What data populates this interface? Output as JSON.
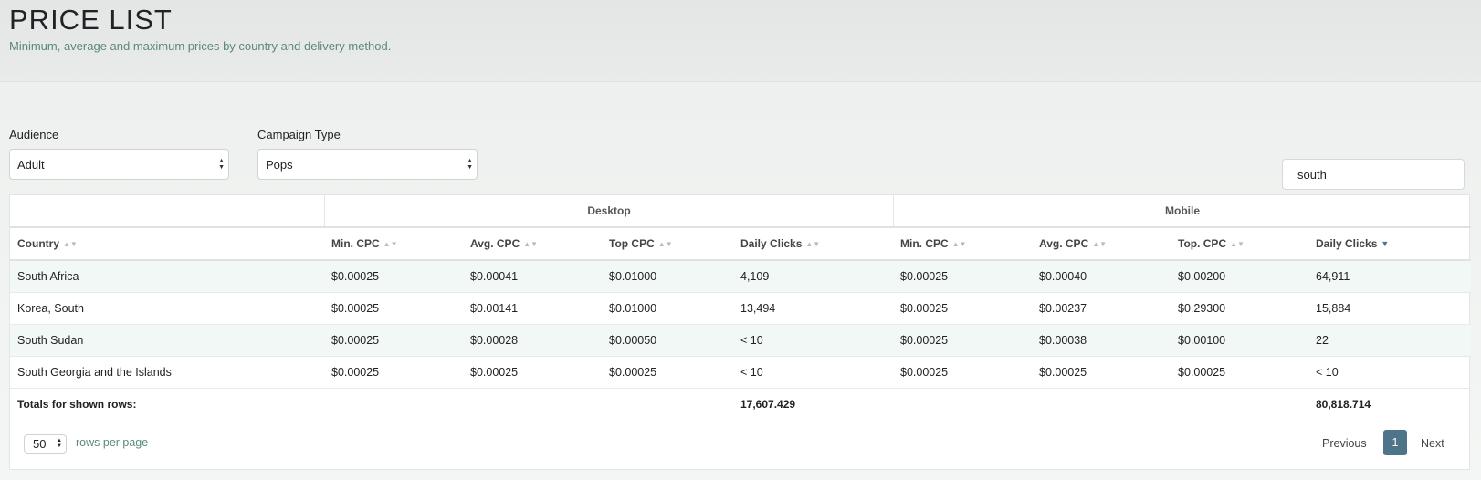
{
  "header": {
    "title": "PRICE LIST",
    "subtitle": "Minimum, average and maximum prices by country and delivery method."
  },
  "filters": {
    "audience": {
      "label": "Audience",
      "value": "Adult"
    },
    "campaign_type": {
      "label": "Campaign Type",
      "value": "Pops"
    }
  },
  "search": {
    "value": "south"
  },
  "table": {
    "groups": {
      "desktop": "Desktop",
      "mobile": "Mobile"
    },
    "columns": [
      "Country",
      "Min. CPC",
      "Avg. CPC",
      "Top CPC",
      "Daily Clicks",
      "Min. CPC",
      "Avg. CPC",
      "Top. CPC",
      "Daily Clicks"
    ],
    "sorted_column": "Daily Clicks (Mobile)",
    "rows": [
      [
        "South Africa",
        "$0.00025",
        "$0.00041",
        "$0.01000",
        "4,109",
        "$0.00025",
        "$0.00040",
        "$0.00200",
        "64,911"
      ],
      [
        "Korea, South",
        "$0.00025",
        "$0.00141",
        "$0.01000",
        "13,494",
        "$0.00025",
        "$0.00237",
        "$0.29300",
        "15,884"
      ],
      [
        "South Sudan",
        "$0.00025",
        "$0.00028",
        "$0.00050",
        "< 10",
        "$0.00025",
        "$0.00038",
        "$0.00100",
        "22"
      ],
      [
        "South Georgia and the Islands",
        "$0.00025",
        "$0.00025",
        "$0.00025",
        "< 10",
        "$0.00025",
        "$0.00025",
        "$0.00025",
        "< 10"
      ]
    ],
    "totals": {
      "label": "Totals for shown rows:",
      "desktop_daily_clicks": "17,607.429",
      "mobile_daily_clicks": "80,818.714"
    }
  },
  "pagination": {
    "rows_per_page": "50",
    "rows_per_page_label": "rows per page",
    "previous_label": "Previous",
    "current_page": "1",
    "next_label": "Next"
  },
  "icons": {
    "sort": "sort-updown-icon",
    "sort_desc": "sort-desc-icon",
    "select_arrows": "select-arrows-icon"
  },
  "colors": {
    "accent": "#4d7488",
    "subtitle": "#5a8a78",
    "row_stripe": "#f2f8f5"
  }
}
